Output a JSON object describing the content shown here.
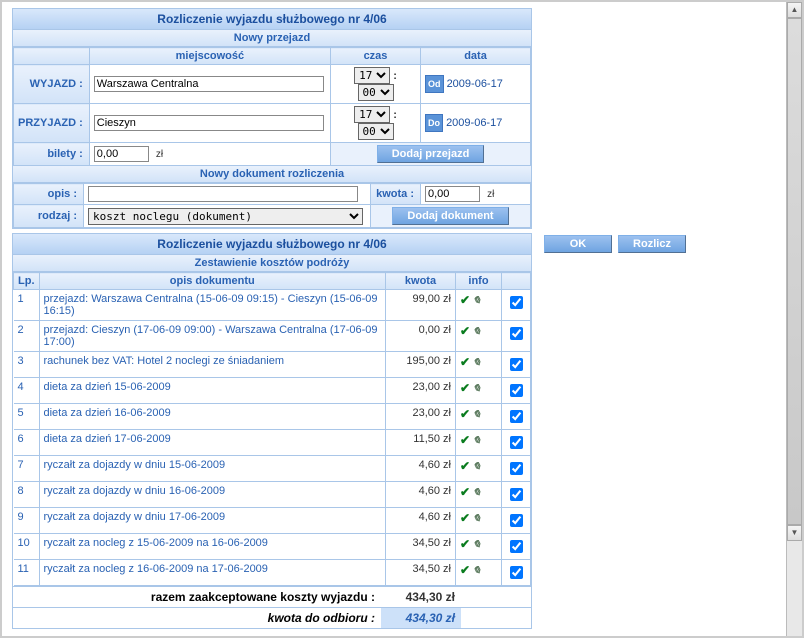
{
  "title1": "Rozliczenie wyjazdu służbowego nr 4/06",
  "new_trip": "Nowy przejazd",
  "headers": {
    "miejscowosc": "miejscowość",
    "czas": "czas",
    "data": "data"
  },
  "wyjazd_label": "WYJAZD :",
  "przyjazd_label": "PRZYJAZD :",
  "bilety_label": "bilety :",
  "wyjazd_city": "Warszawa Centralna",
  "przyjazd_city": "Cieszyn",
  "time_h": "17",
  "time_m": "00",
  "od": "Od",
  "do": "Do",
  "date1": "2009-06-17",
  "date2": "2009-06-17",
  "bilety_val": "0,00",
  "zl": "zł",
  "add_trip": "Dodaj przejazd",
  "new_doc": "Nowy dokument rozliczenia",
  "opis_label": "opis :",
  "kwota_label": "kwota :",
  "kwota_val": "0,00",
  "rodzaj_label": "rodzaj :",
  "rodzaj_val": "koszt noclegu (dokument)",
  "add_doc": "Dodaj dokument",
  "title2": "Rozliczenie wyjazdu służbowego nr 4/06",
  "btn_ok": "OK",
  "btn_rozlicz": "Rozlicz",
  "list_sub": "Zestawienie kosztów podróży",
  "cols": {
    "lp": "Lp.",
    "opis": "opis dokumentu",
    "kwota": "kwota",
    "info": "info"
  },
  "rows": [
    {
      "lp": "1",
      "opis": "przejazd: Warszawa Centralna (15-06-09 09:15) - Cieszyn (15-06-09 16:15)",
      "kwota": "99,00 zł"
    },
    {
      "lp": "2",
      "opis": "przejazd: Cieszyn (17-06-09 09:00) - Warszawa Centralna (17-06-09 17:00)",
      "kwota": "0,00 zł"
    },
    {
      "lp": "3",
      "opis": "rachunek bez VAT: Hotel 2 noclegi ze śniadaniem",
      "kwota": "195,00 zł"
    },
    {
      "lp": "4",
      "opis": "dieta za dzień 15-06-2009",
      "kwota": "23,00 zł"
    },
    {
      "lp": "5",
      "opis": "dieta za dzień 16-06-2009",
      "kwota": "23,00 zł"
    },
    {
      "lp": "6",
      "opis": "dieta za dzień 17-06-2009",
      "kwota": "11,50 zł"
    },
    {
      "lp": "7",
      "opis": "ryczałt za dojazdy w dniu 15-06-2009",
      "kwota": "4,60 zł"
    },
    {
      "lp": "8",
      "opis": "ryczałt za dojazdy w dniu 16-06-2009",
      "kwota": "4,60 zł"
    },
    {
      "lp": "9",
      "opis": "ryczałt za dojazdy w dniu 17-06-2009",
      "kwota": "4,60 zł"
    },
    {
      "lp": "10",
      "opis": "ryczałt za nocleg z 15-06-2009 na 16-06-2009",
      "kwota": "34,50 zł"
    },
    {
      "lp": "11",
      "opis": "ryczałt za nocleg z 16-06-2009 na 17-06-2009",
      "kwota": "34,50 zł"
    }
  ],
  "total_label": "razem zaakceptowane koszty wyjazdu :",
  "total_val": "434,30 zł",
  "due_label": "kwota do odbioru :",
  "due_val": "434,30 zł"
}
